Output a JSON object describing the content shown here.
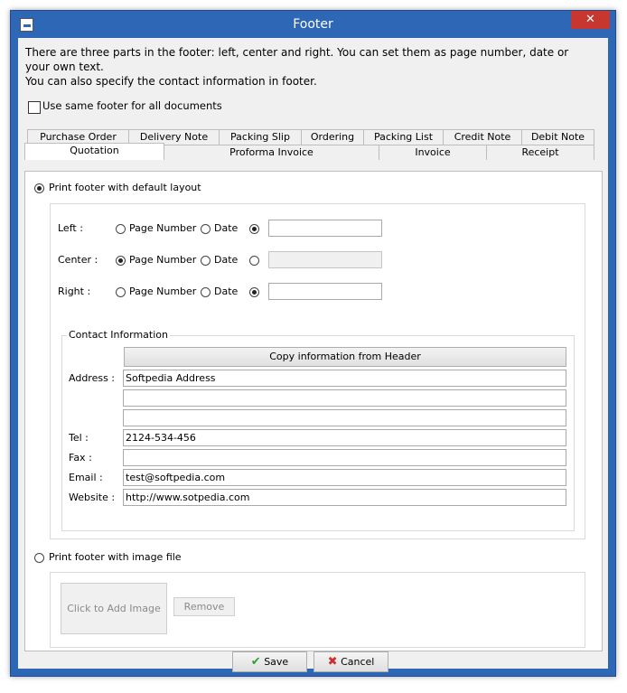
{
  "window": {
    "title": "Footer",
    "close_glyph": "✕"
  },
  "intro": {
    "line1": "There are three parts in the footer: left, center and right. You can set them as page number, date or your own text.",
    "line2": "You can also specify the contact information in footer."
  },
  "same_footer": {
    "label": "Use same footer for all documents",
    "checked": false
  },
  "tabs_row1": [
    "Purchase Order",
    "Delivery Note",
    "Packing Slip",
    "Ordering",
    "Packing List",
    "Credit Note",
    "Debit Note"
  ],
  "tabs_row2": [
    "Quotation",
    "Proforma Invoice",
    "Invoice",
    "Receipt"
  ],
  "active_tab": "Quotation",
  "default_layout": {
    "label": "Print footer with default layout",
    "selected": true
  },
  "parts": {
    "option_page": "Page Number",
    "option_date": "Date",
    "left": {
      "label": "Left :",
      "selected": "custom",
      "text": ""
    },
    "center": {
      "label": "Center :",
      "selected": "page_number",
      "text": ""
    },
    "right": {
      "label": "Right :",
      "selected": "custom",
      "text": ""
    }
  },
  "contact": {
    "title": "Contact Information",
    "copy_button": "Copy information from Header",
    "address_label": "Address :",
    "address1": "Softpedia Address",
    "address2": "",
    "address3": "",
    "tel_label": "Tel :",
    "tel": "2124-534-456",
    "fax_label": "Fax :",
    "fax": "",
    "email_label": "Email :",
    "email": "test@softpedia.com",
    "website_label": "Website :",
    "website": "http://www.sotpedia.com"
  },
  "image_footer": {
    "label": "Print footer with image file",
    "selected": false,
    "add_image": "Click to Add Image",
    "remove": "Remove"
  },
  "footer_buttons": {
    "save": "Save",
    "cancel": "Cancel"
  },
  "colors": {
    "titlebar": "#2f67b7",
    "close": "#c7372f",
    "save_check": "#2e9e2e",
    "cancel_x": "#d12d2d"
  }
}
